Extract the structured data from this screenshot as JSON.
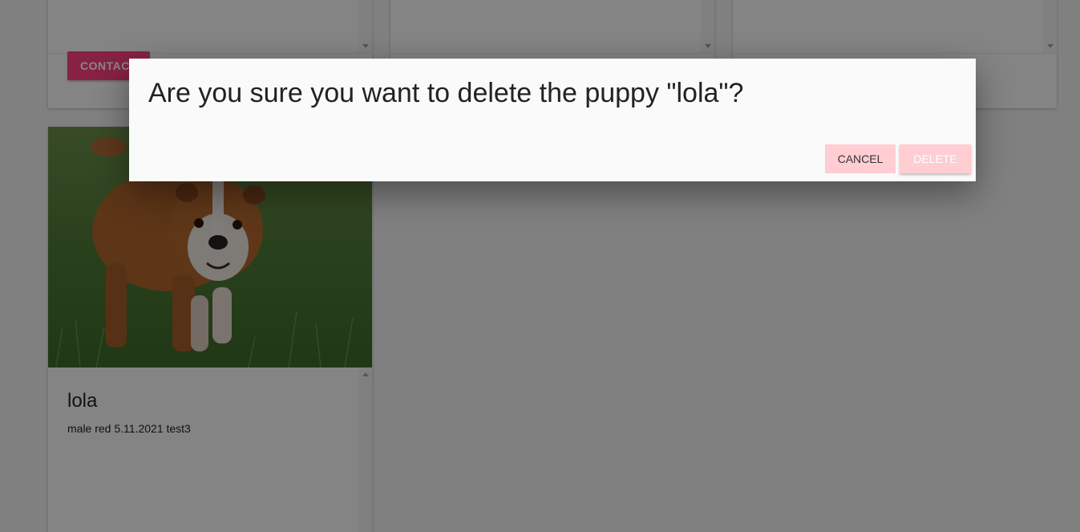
{
  "cards_top": [
    {
      "contact_label": "CONTACT"
    },
    {
      "contact_label": ""
    },
    {
      "contact_label": ""
    }
  ],
  "puppy": {
    "name": "lola",
    "details": "male red 5.11.2021 test3"
  },
  "dialog": {
    "title": "Are you sure you want to delete the puppy \"lola\"?",
    "cancel_label": "CANCEL",
    "delete_label": "DELETE"
  },
  "colors": {
    "accent": "#ff4081",
    "dialog_button_bg": "#ffcdd2",
    "overlay": "rgba(0,0,0,0.47)"
  }
}
